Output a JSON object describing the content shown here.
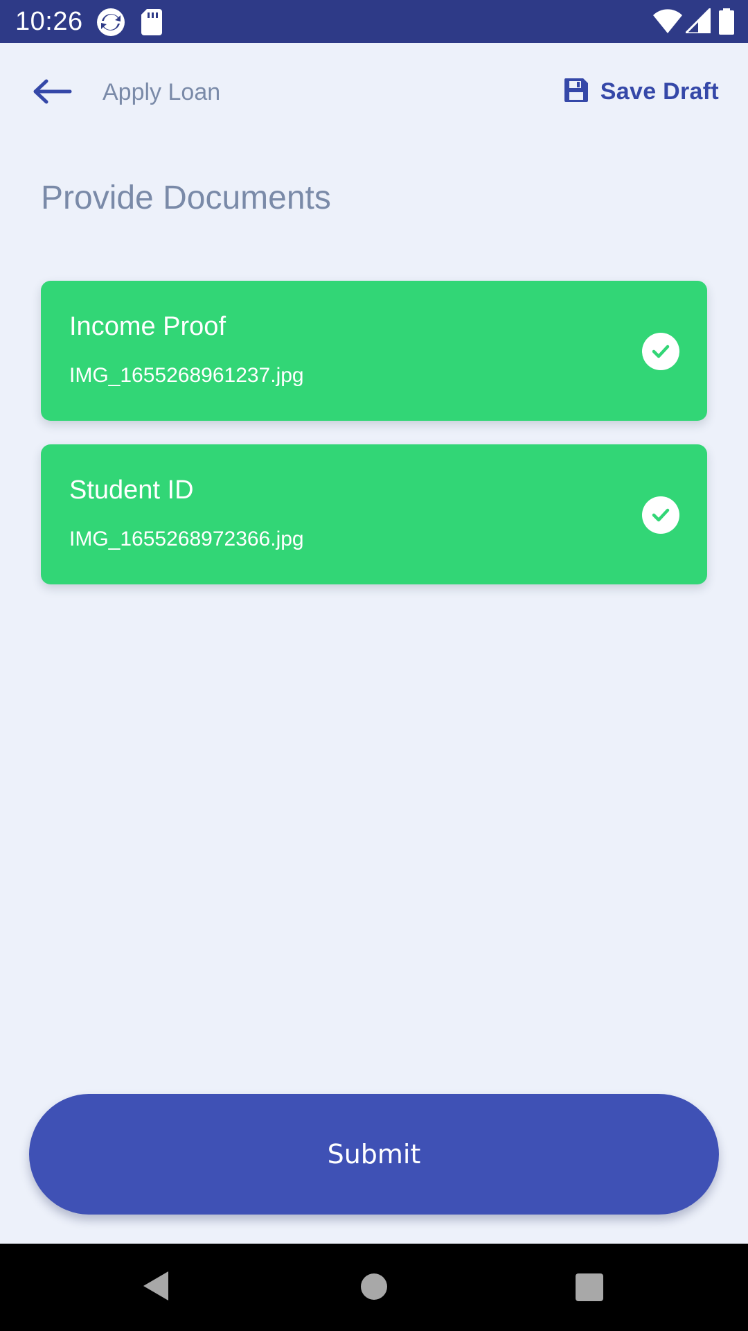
{
  "status_bar": {
    "time": "10:26",
    "icons": [
      "sync-app-icon",
      "sd-card-icon",
      "wifi-icon",
      "signal-icon",
      "battery-icon"
    ],
    "background": "#2e3a87"
  },
  "app_bar": {
    "back_icon": "arrow-left-icon",
    "title": "Apply Loan",
    "save_icon": "floppy-disk-icon",
    "save_label": "Save Draft",
    "accent": "#3548a8"
  },
  "page": {
    "heading": "Provide Documents"
  },
  "documents": [
    {
      "title": "Income Proof",
      "file": "IMG_1655268961237.jpg",
      "status_icon": "check-circle-icon",
      "uploaded": true
    },
    {
      "title": "Student ID",
      "file": "IMG_1655268972366.jpg",
      "status_icon": "check-circle-icon",
      "uploaded": true
    }
  ],
  "card_color": "#32d676",
  "submit": {
    "label": "Submit",
    "color": "#3f51b5"
  },
  "nav_bar": {
    "icons": [
      "back-triangle-icon",
      "home-circle-icon",
      "recents-square-icon"
    ]
  }
}
